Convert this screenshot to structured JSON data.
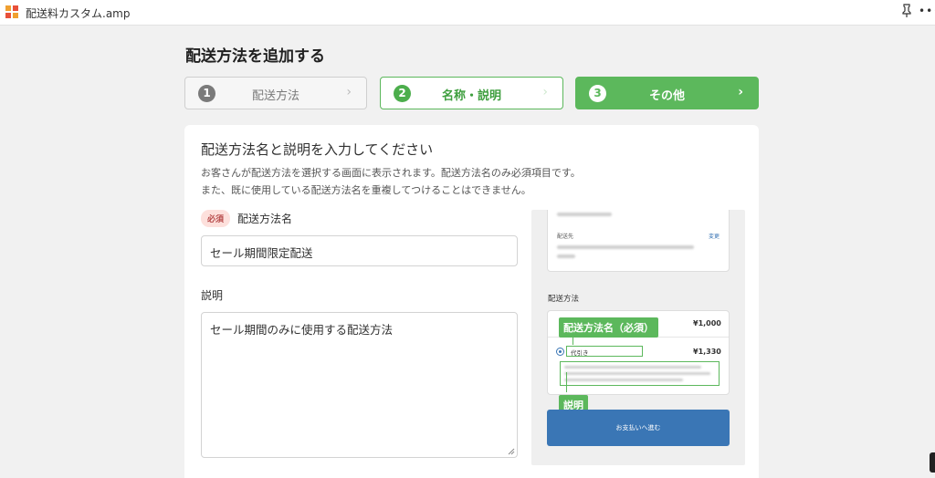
{
  "window": {
    "title": "配送料カスタム.amp",
    "more": "•••"
  },
  "page": {
    "title": "配送方法を追加する"
  },
  "steps": [
    {
      "num": "1",
      "label": "配送方法",
      "chevron": "›"
    },
    {
      "num": "2",
      "label": "名称・説明",
      "chevron": "›"
    },
    {
      "num": "3",
      "label": "その他",
      "chevron": "›"
    }
  ],
  "form": {
    "heading": "配送方法名と説明を入力してください",
    "description_line1": "お客さんが配送方法を選択する画面に表示されます。配送方法名のみ必須項目です。",
    "description_line2": "また、既に使用している配送方法名を重複してつけることはできません。",
    "required_badge": "必須",
    "name_label": "配送方法名",
    "name_value": "セール期間限定配送",
    "desc_label": "説明",
    "desc_value": "セール期間のみに使用する配送方法"
  },
  "preview": {
    "ship_to_label": "配送先",
    "change_link": "変更",
    "section_title": "配送方法",
    "price1": "¥1,000",
    "option2_name": "代引き",
    "price2": "¥1,330",
    "tag_name": "配送方法名（必須）",
    "tag_desc": "説明",
    "pay_button": "お支払いへ進む"
  },
  "colors": {
    "accent_green": "#5cb85c",
    "button_blue": "#3a76b5",
    "required_bg": "#fde0dc"
  },
  "icons": {
    "logo": "app-logo-icon",
    "pin": "pin-icon",
    "more": "more-icon",
    "chevron": "chevron-right-icon",
    "radio": "radio-selected-icon"
  }
}
